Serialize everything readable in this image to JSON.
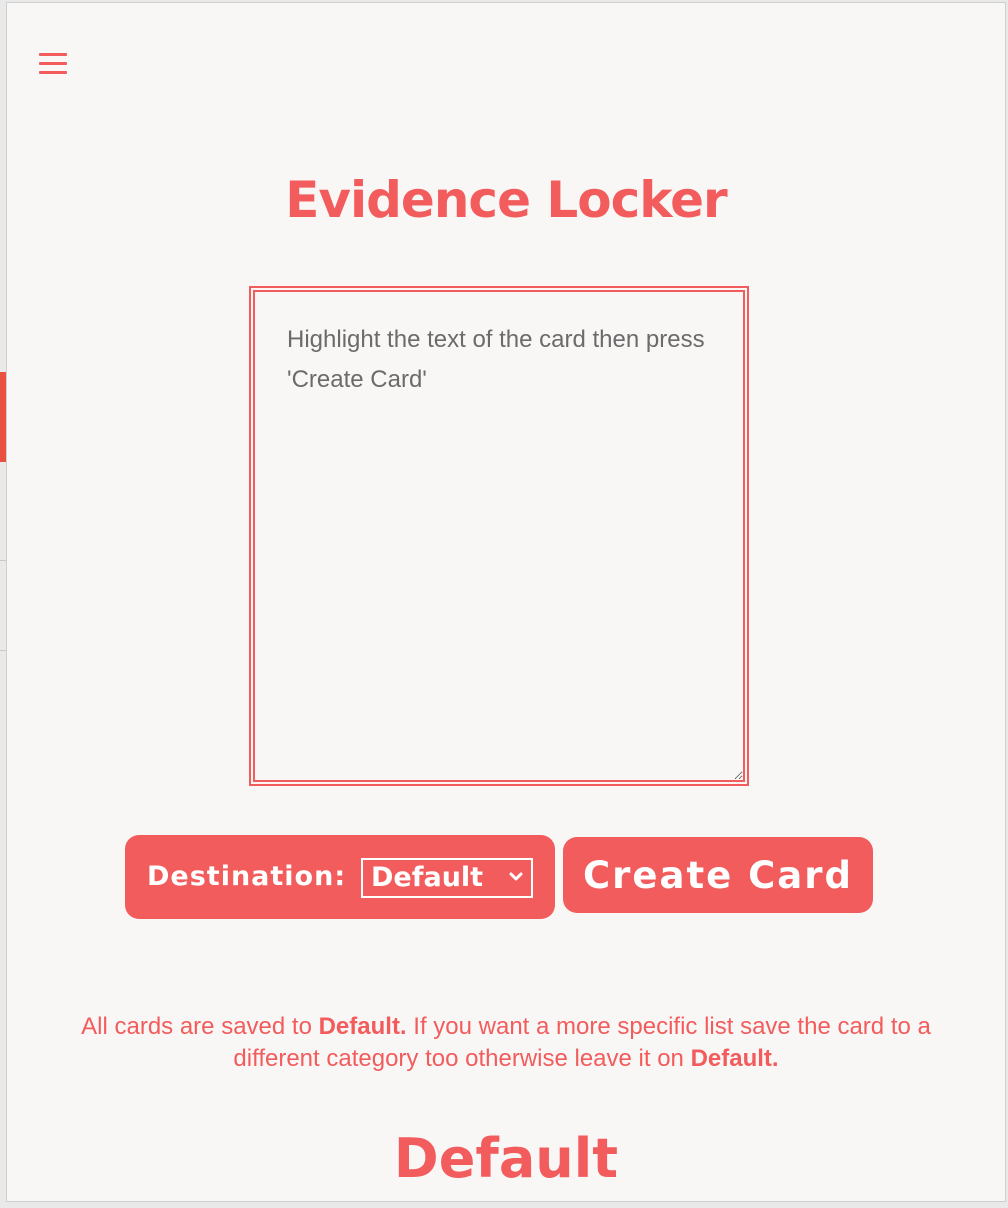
{
  "app": {
    "title": "Evidence Locker"
  },
  "menu": {
    "icon": "hamburger-menu-icon"
  },
  "card_input": {
    "placeholder": "Highlight the text of the card then press 'Create Card'",
    "value": ""
  },
  "destination": {
    "label": "Destination:",
    "selected": "Default",
    "icon": "chevron-down-icon"
  },
  "create_button": {
    "label": "Create Card"
  },
  "info": {
    "part1": "All cards are saved to ",
    "bold1": "Default.",
    "part2": " If you want a more specific list save the card to a different category too otherwise leave it on ",
    "bold2": "Default."
  },
  "section": {
    "title": "Default"
  },
  "colors": {
    "accent": "#f25c5c",
    "background": "#f9f7f6"
  }
}
